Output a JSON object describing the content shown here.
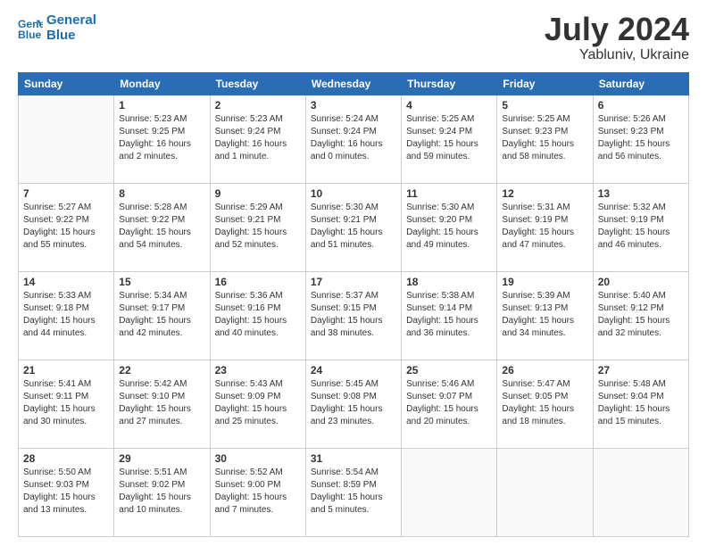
{
  "logo": {
    "line1": "General",
    "line2": "Blue"
  },
  "title": {
    "month_year": "July 2024",
    "location": "Yabluniv, Ukraine"
  },
  "weekdays": [
    "Sunday",
    "Monday",
    "Tuesday",
    "Wednesday",
    "Thursday",
    "Friday",
    "Saturday"
  ],
  "weeks": [
    [
      {
        "day": "",
        "info": ""
      },
      {
        "day": "1",
        "info": "Sunrise: 5:23 AM\nSunset: 9:25 PM\nDaylight: 16 hours\nand 2 minutes."
      },
      {
        "day": "2",
        "info": "Sunrise: 5:23 AM\nSunset: 9:24 PM\nDaylight: 16 hours\nand 1 minute."
      },
      {
        "day": "3",
        "info": "Sunrise: 5:24 AM\nSunset: 9:24 PM\nDaylight: 16 hours\nand 0 minutes."
      },
      {
        "day": "4",
        "info": "Sunrise: 5:25 AM\nSunset: 9:24 PM\nDaylight: 15 hours\nand 59 minutes."
      },
      {
        "day": "5",
        "info": "Sunrise: 5:25 AM\nSunset: 9:23 PM\nDaylight: 15 hours\nand 58 minutes."
      },
      {
        "day": "6",
        "info": "Sunrise: 5:26 AM\nSunset: 9:23 PM\nDaylight: 15 hours\nand 56 minutes."
      }
    ],
    [
      {
        "day": "7",
        "info": "Sunrise: 5:27 AM\nSunset: 9:22 PM\nDaylight: 15 hours\nand 55 minutes."
      },
      {
        "day": "8",
        "info": "Sunrise: 5:28 AM\nSunset: 9:22 PM\nDaylight: 15 hours\nand 54 minutes."
      },
      {
        "day": "9",
        "info": "Sunrise: 5:29 AM\nSunset: 9:21 PM\nDaylight: 15 hours\nand 52 minutes."
      },
      {
        "day": "10",
        "info": "Sunrise: 5:30 AM\nSunset: 9:21 PM\nDaylight: 15 hours\nand 51 minutes."
      },
      {
        "day": "11",
        "info": "Sunrise: 5:30 AM\nSunset: 9:20 PM\nDaylight: 15 hours\nand 49 minutes."
      },
      {
        "day": "12",
        "info": "Sunrise: 5:31 AM\nSunset: 9:19 PM\nDaylight: 15 hours\nand 47 minutes."
      },
      {
        "day": "13",
        "info": "Sunrise: 5:32 AM\nSunset: 9:19 PM\nDaylight: 15 hours\nand 46 minutes."
      }
    ],
    [
      {
        "day": "14",
        "info": "Sunrise: 5:33 AM\nSunset: 9:18 PM\nDaylight: 15 hours\nand 44 minutes."
      },
      {
        "day": "15",
        "info": "Sunrise: 5:34 AM\nSunset: 9:17 PM\nDaylight: 15 hours\nand 42 minutes."
      },
      {
        "day": "16",
        "info": "Sunrise: 5:36 AM\nSunset: 9:16 PM\nDaylight: 15 hours\nand 40 minutes."
      },
      {
        "day": "17",
        "info": "Sunrise: 5:37 AM\nSunset: 9:15 PM\nDaylight: 15 hours\nand 38 minutes."
      },
      {
        "day": "18",
        "info": "Sunrise: 5:38 AM\nSunset: 9:14 PM\nDaylight: 15 hours\nand 36 minutes."
      },
      {
        "day": "19",
        "info": "Sunrise: 5:39 AM\nSunset: 9:13 PM\nDaylight: 15 hours\nand 34 minutes."
      },
      {
        "day": "20",
        "info": "Sunrise: 5:40 AM\nSunset: 9:12 PM\nDaylight: 15 hours\nand 32 minutes."
      }
    ],
    [
      {
        "day": "21",
        "info": "Sunrise: 5:41 AM\nSunset: 9:11 PM\nDaylight: 15 hours\nand 30 minutes."
      },
      {
        "day": "22",
        "info": "Sunrise: 5:42 AM\nSunset: 9:10 PM\nDaylight: 15 hours\nand 27 minutes."
      },
      {
        "day": "23",
        "info": "Sunrise: 5:43 AM\nSunset: 9:09 PM\nDaylight: 15 hours\nand 25 minutes."
      },
      {
        "day": "24",
        "info": "Sunrise: 5:45 AM\nSunset: 9:08 PM\nDaylight: 15 hours\nand 23 minutes."
      },
      {
        "day": "25",
        "info": "Sunrise: 5:46 AM\nSunset: 9:07 PM\nDaylight: 15 hours\nand 20 minutes."
      },
      {
        "day": "26",
        "info": "Sunrise: 5:47 AM\nSunset: 9:05 PM\nDaylight: 15 hours\nand 18 minutes."
      },
      {
        "day": "27",
        "info": "Sunrise: 5:48 AM\nSunset: 9:04 PM\nDaylight: 15 hours\nand 15 minutes."
      }
    ],
    [
      {
        "day": "28",
        "info": "Sunrise: 5:50 AM\nSunset: 9:03 PM\nDaylight: 15 hours\nand 13 minutes."
      },
      {
        "day": "29",
        "info": "Sunrise: 5:51 AM\nSunset: 9:02 PM\nDaylight: 15 hours\nand 10 minutes."
      },
      {
        "day": "30",
        "info": "Sunrise: 5:52 AM\nSunset: 9:00 PM\nDaylight: 15 hours\nand 7 minutes."
      },
      {
        "day": "31",
        "info": "Sunrise: 5:54 AM\nSunset: 8:59 PM\nDaylight: 15 hours\nand 5 minutes."
      },
      {
        "day": "",
        "info": ""
      },
      {
        "day": "",
        "info": ""
      },
      {
        "day": "",
        "info": ""
      }
    ]
  ]
}
